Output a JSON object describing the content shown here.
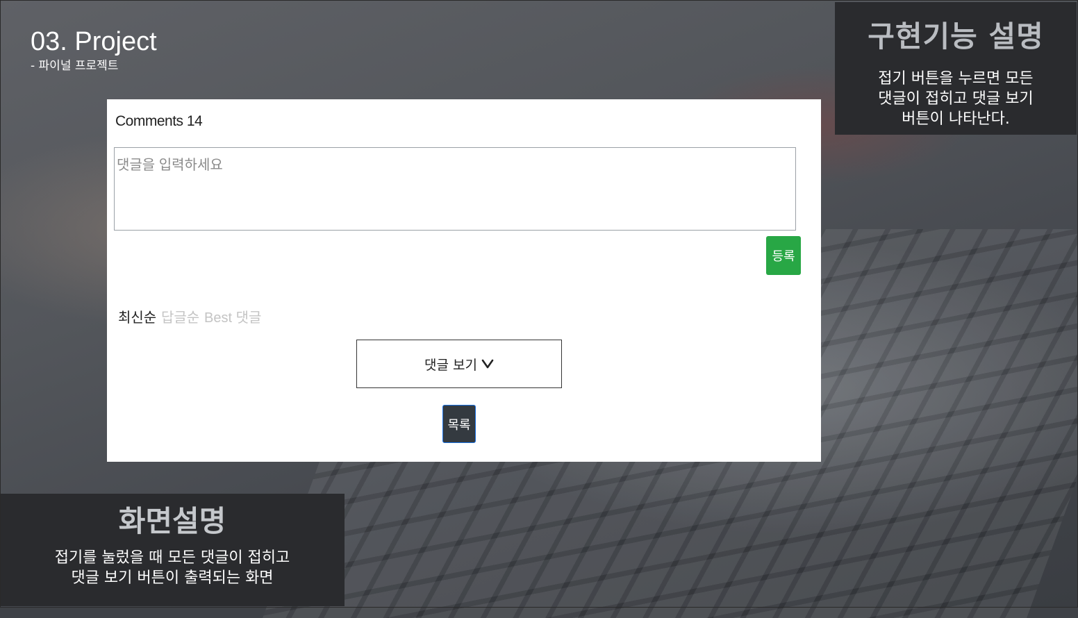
{
  "slide": {
    "title": "03.  Project",
    "subtitle": "- 파이널 프로젝트"
  },
  "feature_panel": {
    "heading": "구현기능 설명",
    "description": "접기 버튼을 누르면 모든 댓글이 접히고 댓글 보기 버튼이 나타난다."
  },
  "screen_panel": {
    "heading": "화면설명",
    "line1": "접기를 눌렀을 때 모든 댓글이 접히고",
    "line2": "댓글 보기 버튼이 출력되는 화면"
  },
  "comments": {
    "title": "Comments 14",
    "input_placeholder": "댓글을 입력하세요",
    "register_label": "등록",
    "sort_tabs": [
      {
        "label": "최신순",
        "active": true
      },
      {
        "label": "답글순",
        "active": false
      },
      {
        "label": "Best 댓글",
        "active": false
      }
    ],
    "view_button_label": "댓글 보기",
    "view_button_icon": "chevron-down-icon",
    "list_button_label": "목록"
  },
  "colors": {
    "panel_bg": "#2a2b2e",
    "register_green": "#28a745",
    "list_dark": "#343a40"
  }
}
